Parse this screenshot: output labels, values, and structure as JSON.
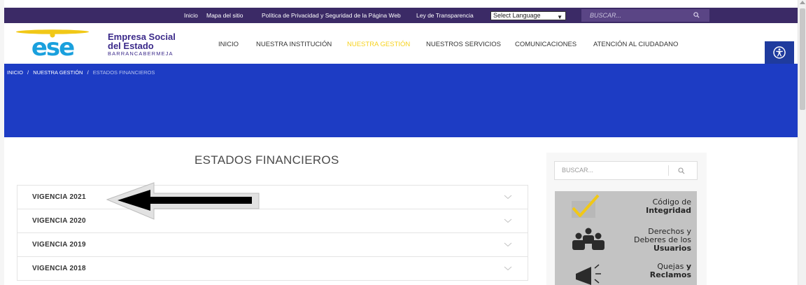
{
  "topbar": {
    "links": [
      "Inicio",
      "Mapa del sitio",
      "Política de Privacidad y Seguridad de la Página Web",
      "Ley de Transparencia"
    ],
    "language_select": "Select Language",
    "search_placeholder": "BUSCAR..."
  },
  "header": {
    "brand_line1": "Empresa Social",
    "brand_line2": "del Estado",
    "brand_line3": "BARRANCABERMEJA",
    "nav": [
      "INICIO",
      "NUESTRA INSTITUCIÓN",
      "NUESTRA GESTIÓN",
      "NUESTROS SERVICIOS",
      "COMUNICACIONES",
      "ATENCIÓN AL CIUDADANO"
    ],
    "active_nav": "NUESTRA GESTIÓN"
  },
  "breadcrumb": {
    "items": [
      "INICIO",
      "NUESTRA GESTIÓN",
      "ESTADOS FINANCIEROS"
    ],
    "separator": "/"
  },
  "main": {
    "title": "ESTADOS FINANCIEROS",
    "accordion": [
      "VIGENCIA 2021",
      "VIGENCIA 2020",
      "VIGENCIA 2019",
      "VIGENCIA 2018"
    ]
  },
  "sidebar": {
    "search_placeholder": "BUSCAR...",
    "banners": [
      {
        "normal": "Código de",
        "bold": "Integridad"
      },
      {
        "normal": "Derechos y",
        "normal2": "Deberes de los",
        "bold": "Usuarios"
      },
      {
        "normal": "Quejas",
        "bold_inline": "y",
        "bold": "Reclamos"
      }
    ]
  },
  "colors": {
    "topbar": "#3b2a66",
    "hero": "#1d3cc4",
    "active_nav": "#f7d21d",
    "brand": "#3b2a8a"
  },
  "icons": [
    "search-icon",
    "accessibility-icon",
    "chevron-down-icon",
    "arrow-pointer-icon",
    "checkmark-icon",
    "users-group-icon",
    "megaphone-icon"
  ]
}
